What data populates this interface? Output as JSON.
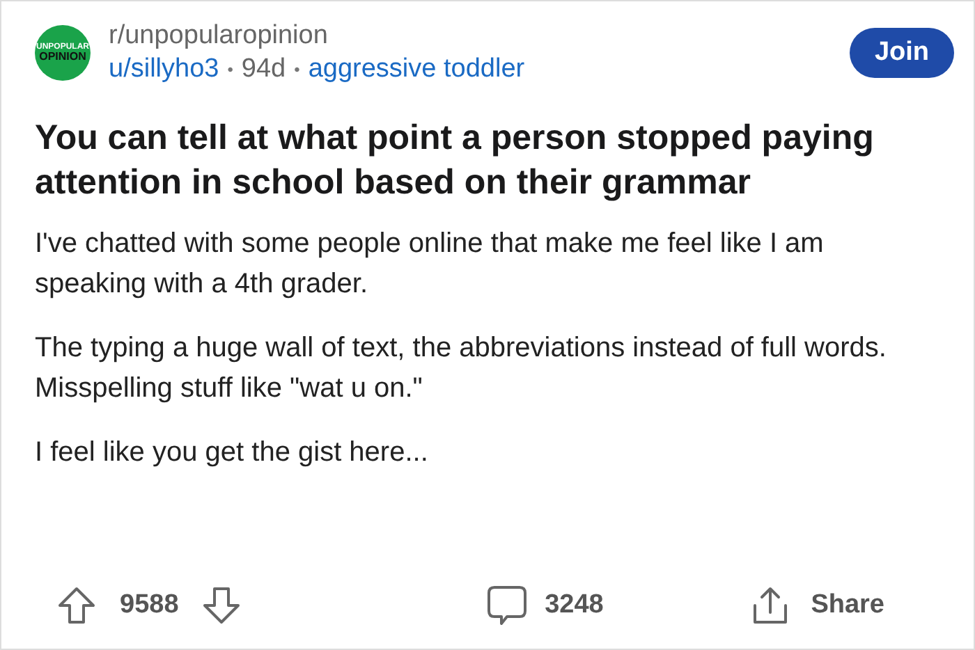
{
  "post": {
    "community_logo": {
      "lines": [
        "UNPOPULAR",
        "OPINION"
      ]
    },
    "community": "r/unpopularopinion",
    "author": "u/sillyho3",
    "separator": "•",
    "age": "94d",
    "flair": "aggressive toddler",
    "join_button": "Join",
    "title": "You can tell at what point a person stopped paying attention in school based on their grammar",
    "paragraphs": [
      "I've chatted with some people online that make me feel like I am speaking with a 4th grader.",
      "The typing a huge wall of text, the abbreviations instead of full words. Misspelling stuff like \"wat u on.\"",
      "I feel like you get the gist here..."
    ],
    "votes": "9588",
    "comments": "3248",
    "share": "Share"
  }
}
